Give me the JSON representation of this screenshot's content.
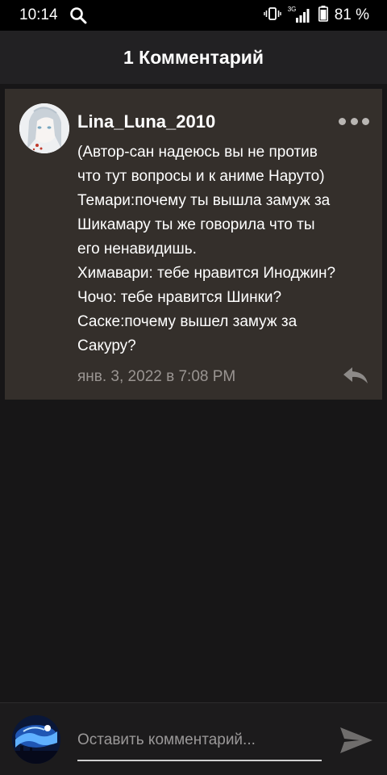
{
  "status_bar": {
    "time": "10:14",
    "network": "3G",
    "battery_percent": "81 %",
    "icons": [
      "search-icon",
      "vibrate-icon",
      "signal-icon",
      "battery-icon"
    ]
  },
  "header": {
    "title": "1 Комментарий"
  },
  "comment": {
    "username": "Lina_Luna_2010",
    "body_lines": [
      "(Автор-сан надеюсь вы не против",
      "что тут вопросы и к аниме Наруто)",
      "Темари:почему ты вышла замуж за",
      "Шикамару ты же говорила что ты",
      "его ненавидишь.",
      "Химавари: тебе нравится Иноджин?",
      "Чочо: тебе нравится Шинки?",
      "Саске:почему вышел замуж за",
      "Сакуру?"
    ],
    "timestamp": "янв. 3, 2022 в 7:08 PM",
    "icons": [
      "more-icon",
      "reply-icon"
    ]
  },
  "footer": {
    "input_placeholder": "Оставить комментарий...",
    "icons": [
      "send-icon"
    ]
  },
  "colors": {
    "background": "#171617",
    "header": "#222123",
    "card": "#342f2b",
    "muted_text": "#9a9592"
  }
}
